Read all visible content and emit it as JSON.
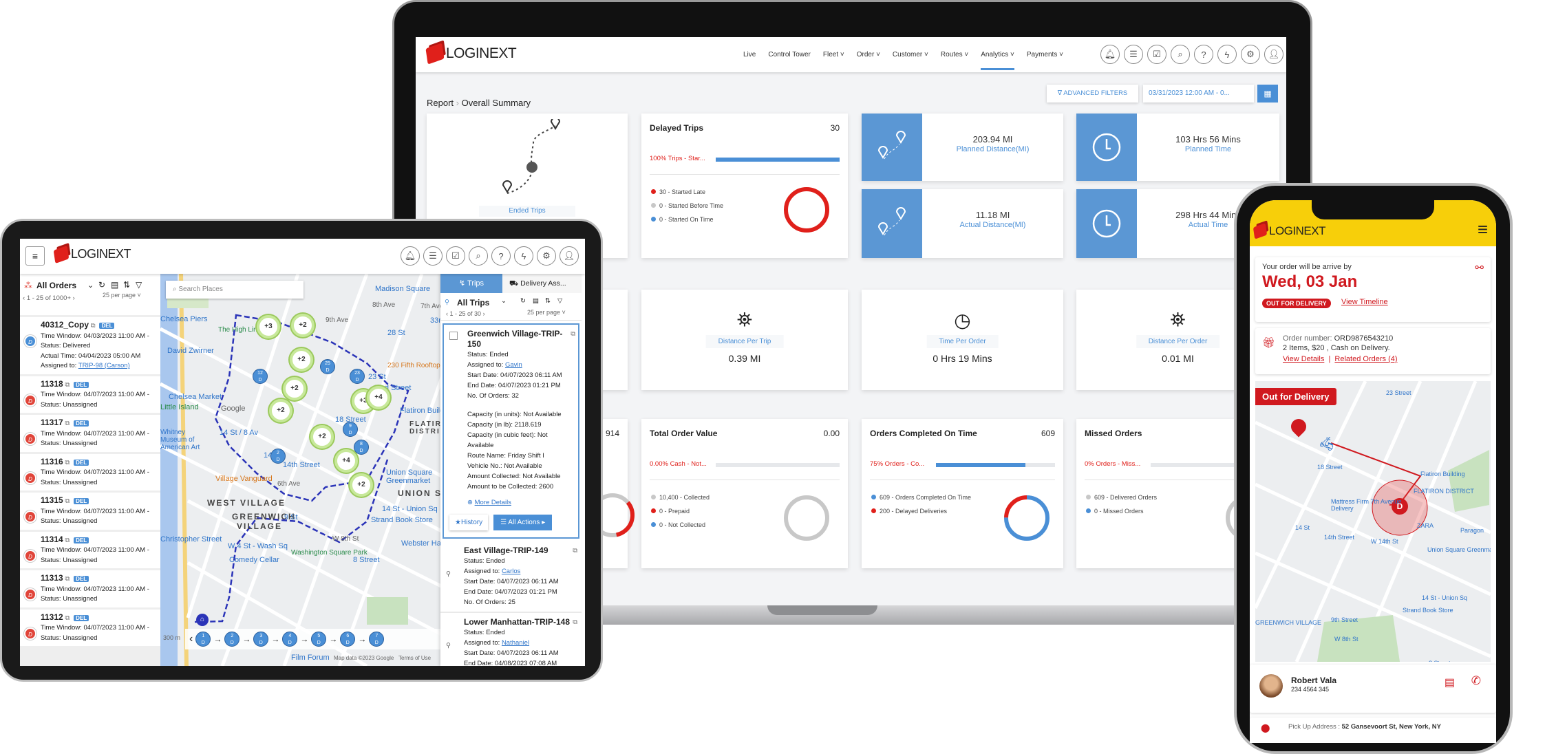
{
  "laptop": {
    "brand": "LOGINEXT",
    "nav": [
      "Live",
      "Control Tower",
      "Fleet",
      "Order",
      "Customer",
      "Routes",
      "Analytics",
      "Payments"
    ],
    "active_nav": "Analytics",
    "icons": [
      "bell-icon",
      "chat-icon",
      "checklist-icon",
      "search-icon",
      "help-icon",
      "bolt-icon",
      "gear-icon",
      "user-icon"
    ],
    "breadcrumb": {
      "parent": "Report",
      "current": "Overall Summary"
    },
    "advanced_filters": "ADVANCED FILTERS",
    "date_range": "03/31/2023 12:00 AM - 0...",
    "ended_trips": {
      "label": "Ended Trips"
    },
    "delayed_trips": {
      "title": "Delayed Trips",
      "value": "30",
      "bar_label": "100% Trips - Star...",
      "bar_pct": 100,
      "legend": [
        "30 - Started Late",
        "0 - Started Before Time",
        "0 - Started On Time"
      ],
      "values": [
        30,
        0,
        0
      ]
    },
    "planned_distance": {
      "value": "203.94 MI",
      "label": "Planned Distance(MI)"
    },
    "planned_time": {
      "value": "103 Hrs 56 Mins",
      "label": "Planned Time"
    },
    "actual_distance": {
      "value": "11.18 MI",
      "label": "Actual Distance(MI)"
    },
    "actual_time": {
      "value": "298 Hrs 44 Mins",
      "label": "Actual Time"
    },
    "distance_per_trip": {
      "label": "Distance Per Trip",
      "value": "0.39 MI"
    },
    "time_per_order": {
      "label": "Time Per Order",
      "value": "0 Hrs 19 Mins"
    },
    "distance_per_order": {
      "label": "Distance Per Order",
      "value": "0.01 MI"
    },
    "partial_card": {
      "value": "914"
    },
    "total_order_value": {
      "title": "Total Order Value",
      "value": "0.00",
      "bar_label": "0.00% Cash - Not...",
      "bar_pct": 0,
      "legend": [
        "10,400 - Collected",
        "0 - Prepaid",
        "0 - Not Collected"
      ],
      "values": [
        10400,
        0,
        0
      ]
    },
    "orders_on_time": {
      "title": "Orders Completed On Time",
      "value": "609",
      "bar_label": "75% Orders - Co...",
      "bar_pct": 75,
      "legend": [
        "609 - Orders Completed On Time",
        "200 - Delayed Deliveries"
      ],
      "values": [
        609,
        200
      ]
    },
    "missed_orders": {
      "title": "Missed Orders",
      "bar_label": "0% Orders - Miss...",
      "bar_pct": 0,
      "legend": [
        "609 - Delivered Orders",
        "0 - Missed Orders"
      ],
      "values": [
        609,
        0
      ]
    },
    "colors": {
      "accent": "#4a8fd6",
      "red": "#e0201b",
      "gray": "#c8c8c8"
    }
  },
  "tablet": {
    "brand": "LOGINEXT",
    "orders": {
      "title": "All Orders",
      "pagination": "1 - 25 of 1000+",
      "per_page": "25 per page",
      "items": [
        {
          "id": "40312_Copy",
          "badge": "DEL",
          "lines": [
            "Time Window: 04/03/2023 11:00 AM -",
            "Status: Delivered",
            "Actual Time: 04/04/2023 05:00 AM"
          ],
          "assigned_label": "Assigned to:",
          "assigned": "TRIP-98 (Carson)",
          "status": "delivered"
        },
        {
          "id": "11318",
          "badge": "DEL",
          "lines": [
            "Time Window: 04/07/2023 11:00 AM -",
            "Status: Unassigned"
          ]
        },
        {
          "id": "11317",
          "badge": "DEL",
          "lines": [
            "Time Window: 04/07/2023 11:00 AM -",
            "Status: Unassigned"
          ]
        },
        {
          "id": "11316",
          "badge": "DEL",
          "lines": [
            "Time Window: 04/07/2023 11:00 AM -",
            "Status: Unassigned"
          ]
        },
        {
          "id": "11315",
          "badge": "DEL",
          "lines": [
            "Time Window: 04/07/2023 11:00 AM -",
            "Status: Unassigned"
          ]
        },
        {
          "id": "11314",
          "badge": "DEL",
          "lines": [
            "Time Window: 04/07/2023 11:00 AM -",
            "Status: Unassigned"
          ]
        },
        {
          "id": "11313",
          "badge": "DEL",
          "lines": [
            "Time Window: 04/07/2023 11:00 AM -",
            "Status: Unassigned"
          ]
        },
        {
          "id": "11312",
          "badge": "DEL",
          "lines": [
            "Time Window: 04/07/2023 11:00 AM -",
            "Status: Unassigned"
          ]
        }
      ]
    },
    "map": {
      "search_placeholder": "Search Places",
      "labels": [
        "Madison Square",
        "Chelsea Piers",
        "The High Line",
        "David Zwirner",
        "Chelsea Market",
        "Little Island",
        "Google",
        "Whitney Museum of American Art",
        "14 St / 8 Av",
        "14 St",
        "14th Street",
        "Village Vanguard",
        "WEST VILLAGE",
        "GREENWICH VILLAGE",
        "Union Square Greenmarket",
        "UNION SQ",
        "14 St - Union Sq",
        "Strand Book Store",
        "W 4 St - Wash Sq",
        "9 St",
        "Christopher Street",
        "Comedy Cellar",
        "Washington Square Park",
        "8 Street",
        "Flatiron Building",
        "FLATIRON DISTRICT",
        "230 Fifth Rooftop",
        "28 St",
        "23 St",
        "23rd Street",
        "18 Street",
        "33rd",
        "8th Ave",
        "7th Ave",
        "9th Ave",
        "6th Ave",
        "W 8th St",
        "Webster Hall",
        "Film Forum",
        "300 m",
        "Map data ©2023 Google",
        "Terms of Use"
      ],
      "clusters": [
        "+3",
        "+2",
        "+2",
        "+2",
        "+2",
        "+3",
        "+2",
        "+4",
        "+4",
        "+2"
      ],
      "pins": [
        "25",
        "12",
        "23",
        "9",
        "8",
        "2"
      ],
      "steps": [
        "1",
        "2",
        "3",
        "4",
        "5",
        "6",
        "7"
      ]
    },
    "trips": {
      "tab_trips": "Trips",
      "tab_delivery": "Delivery Ass...",
      "title": "All Trips",
      "pagination": "1 - 25 of 30",
      "per_page": "25 per page",
      "selected": {
        "name": "Greenwich Village-TRIP-150",
        "status": "Status: Ended",
        "assigned_label": "Assigned to:",
        "assigned": "Gavin",
        "start": "Start Date: 04/07/2023 06:11 AM",
        "end": "End Date: 04/07/2023 01:21 PM",
        "orders": "No. Of Orders: 32",
        "details": [
          "Capacity (in units): Not Available",
          "Capacity (in lb): 2118.619",
          "Capacity (in cubic feet): Not Available",
          "Route Name: Friday Shift I",
          "Vehicle No.: Not Available",
          "Amount Collected: Not Available",
          "Amount to be Collected: 2600"
        ],
        "more": "More Details",
        "history": "History",
        "all_actions": "All Actions"
      },
      "others": [
        {
          "name": "East Village-TRIP-149",
          "status": "Status: Ended",
          "assigned_label": "Assigned to:",
          "assigned": "Carlos",
          "start": "Start Date: 04/07/2023 06:11 AM",
          "end": "End Date: 04/07/2023 01:21 PM",
          "orders": "No. Of Orders: 25"
        },
        {
          "name": "Lower Manhattan-TRIP-148",
          "status": "Status: Ended",
          "assigned_label": "Assigned to:",
          "assigned": "Nathaniel",
          "start": "Start Date: 04/07/2023 06:11 AM",
          "end": "End Date: 04/08/2023 07:08 AM"
        }
      ]
    }
  },
  "phone": {
    "brand": "LOGINEXT",
    "arrive_label": "Your order will be arrive by",
    "arrive_date": "Wed, 03 Jan",
    "status_badge": "OUT FOR DELIVERY",
    "view_timeline": "View Timeline",
    "order_number_label": "Order number:",
    "order_number": "ORD9876543210",
    "order_summary": "2 Items, $20 , Cash on Delivery.",
    "view_details": "View Details",
    "related_orders": "Related Orders (4)",
    "map_badge": "Out for Delivery",
    "map_labels": [
      "23 Street",
      "18 Street",
      "Flatiron Building",
      "FLATIRON DISTRICT",
      "Mattress Firm 7th Avenue",
      "Delivery",
      "14 St",
      "14th Street",
      "W 14th St",
      "ZARA",
      "Paragon",
      "Union Square Greenmarket",
      "14 St - Union Sq",
      "Strand Book Store",
      "9th Street",
      "GREENWICH VILLAGE",
      "W 8th St",
      "Washington Square Park",
      "8 Street",
      "W 4 St - Wash Sq"
    ],
    "driver_name": "Robert Vala",
    "driver_phone": "234 4564 345",
    "pickup_label": "Pick Up Address :",
    "pickup_address": "52 Gansevoort St, New York, NY",
    "colors": {
      "header": "#f7cf0a",
      "red": "#d0191f"
    }
  }
}
